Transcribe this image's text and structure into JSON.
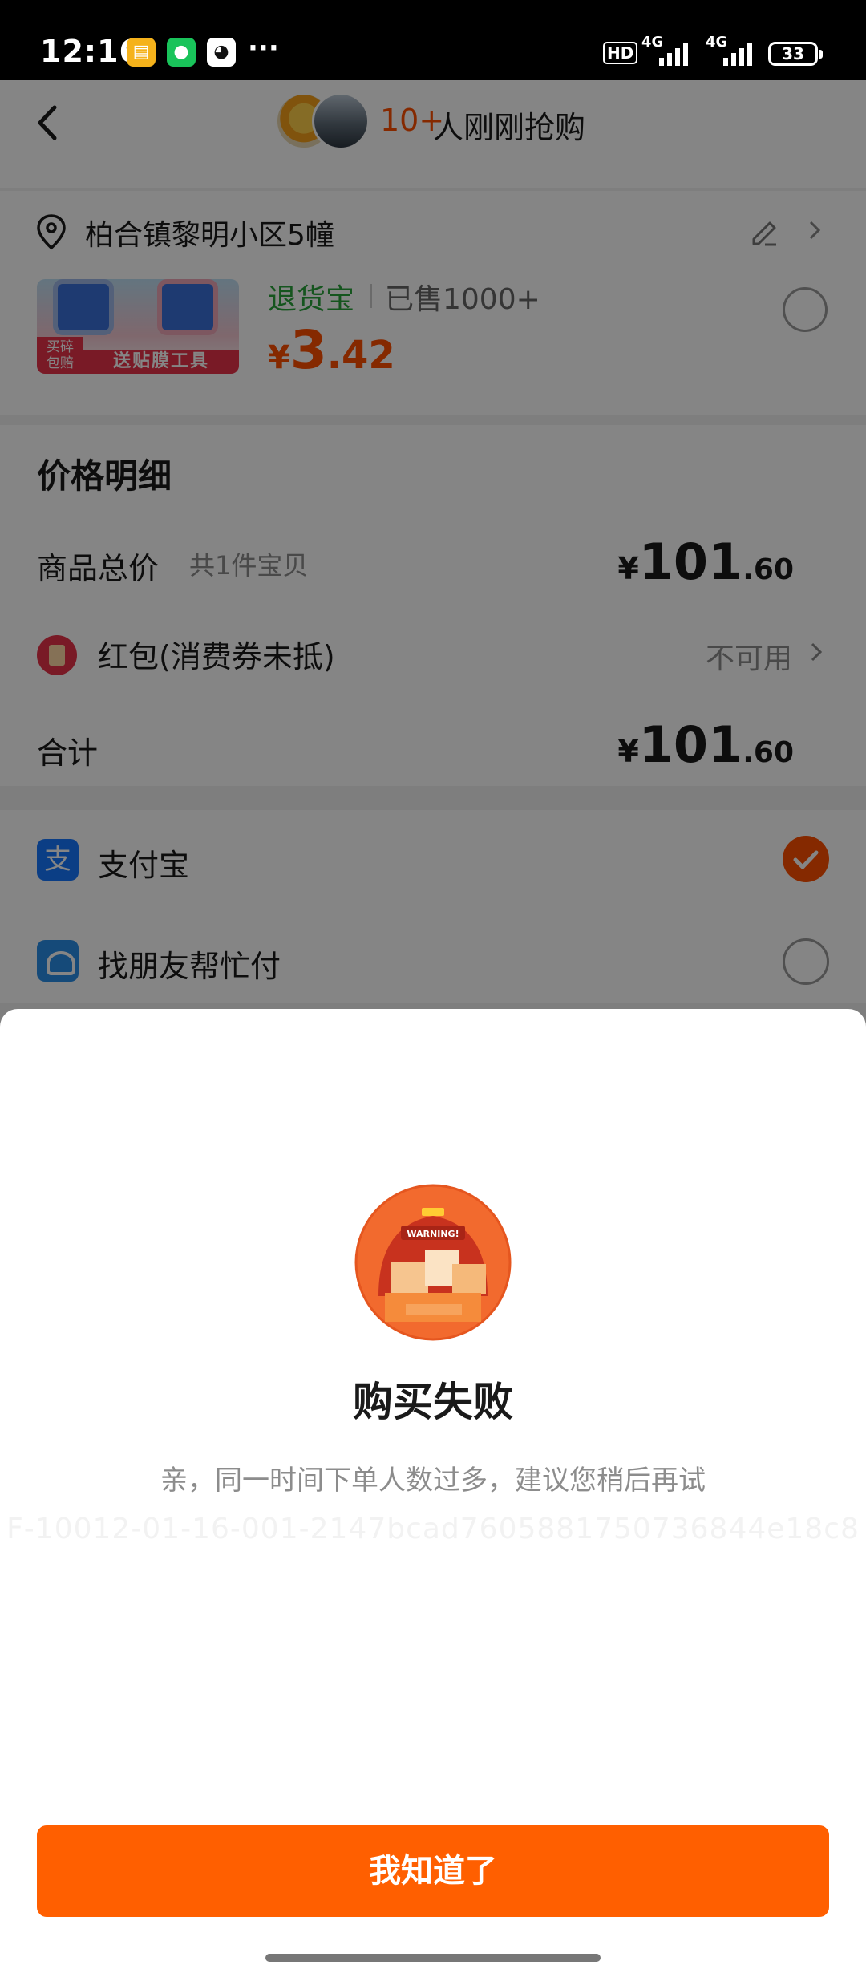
{
  "status_bar": {
    "time": "12:16",
    "notification_icons": [
      "files-icon",
      "wechat-icon",
      "qq-icon"
    ],
    "more_indicator": "···",
    "hd_label": "HD",
    "network_labels": [
      "4G",
      "4G"
    ],
    "battery_level": "33"
  },
  "header": {
    "buyers_count": "10+",
    "buyers_text": "人刚刚抢购"
  },
  "address": {
    "text": "柏合镇黎明小区5幢"
  },
  "product": {
    "thumb_badge": "买碎\n包赔",
    "thumb_ribbon": "送贴膜工具",
    "return_label": "退货宝",
    "sold_label": "已售1000+",
    "price_symbol": "¥",
    "price_integer": "3",
    "price_decimal": ".42"
  },
  "price_detail": {
    "title": "价格明细",
    "goods_total_label": "商品总价",
    "goods_count": "共1件宝贝",
    "goods_total_symbol": "¥",
    "goods_total_integer": "101",
    "goods_total_decimal": ".60",
    "redpack_label": "红包(消费券未抵)",
    "redpack_status": "不可用",
    "total_label": "合计",
    "total_symbol": "¥",
    "total_integer": "101",
    "total_decimal": ".60"
  },
  "payment": {
    "alipay_label": "支付宝",
    "alipay_icon_glyph": "支",
    "friend_pay_label": "找朋友帮忙付",
    "selected": "支付宝"
  },
  "dialog": {
    "title": "购买失败",
    "message": "亲，同一时间下单人数过多，建议您稍后再试",
    "trace_id": "F-10012-01-16-001-2147bcad7605881750736844e18c8",
    "button_label": "我知道了"
  },
  "colors": {
    "accent": "#ff5f00",
    "price": "#ff5000",
    "return_green": "#2aa33a"
  }
}
